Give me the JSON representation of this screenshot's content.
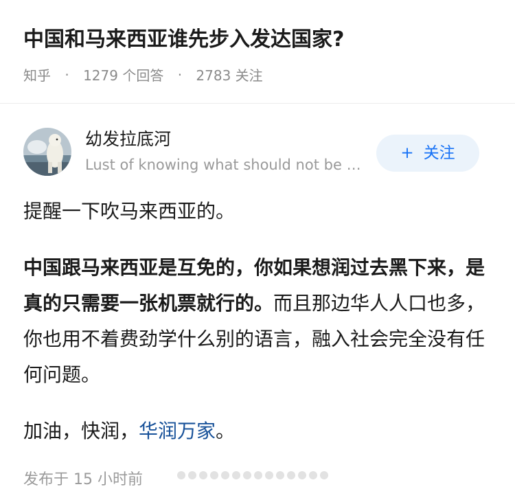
{
  "question": {
    "title": "中国和马来西亚谁先步入发达国家?",
    "source": "知乎",
    "dot": "·",
    "answers": "1279 个回答",
    "followers": "2783 关注"
  },
  "author": {
    "name": "幼发拉底河",
    "bio": "Lust of knowing what should not be known",
    "avatar_icon": "polar-bear-avatar-icon"
  },
  "follow_button": {
    "plus": "+",
    "label": "关注",
    "color": "#1772f6"
  },
  "answer": {
    "p1": "提醒一下吹马来西亚的。",
    "p2_bold": "中国跟马来西亚是互免的，你如果想润过去黑下来，是真的只需要一张机票就行的。",
    "p2_rest": "而且那边华人人口也多，你也用不着费劲学什么别的语言，融入社会完全没有任何问题。",
    "p3_start": "加油，快润，",
    "p3_link": "华润万家",
    "p3_end": "。"
  },
  "footer": {
    "time": "发布于 15 小时前"
  }
}
